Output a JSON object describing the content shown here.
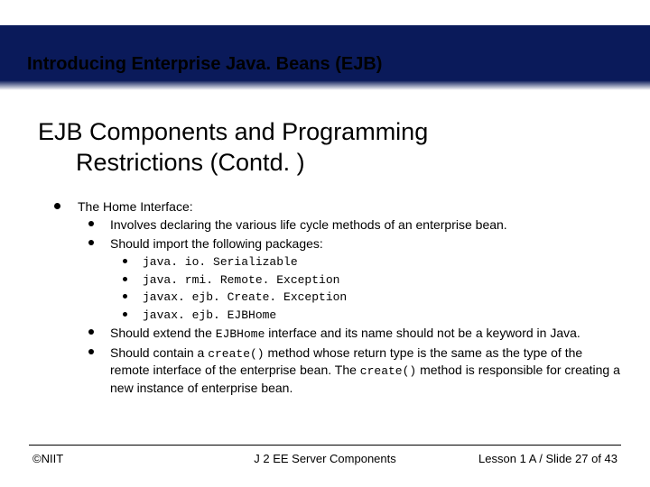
{
  "header": {
    "title": "Introducing Enterprise Java. Beans (EJB)"
  },
  "heading": {
    "line1": "EJB Components and Programming",
    "line2": "Restrictions (Contd. )"
  },
  "bullets": {
    "l1": "The Home Interface:",
    "l2a": "Involves declaring the various life cycle methods of an enterprise bean.",
    "l2b": "Should import the following packages:",
    "pkg1": "java. io. Serializable",
    "pkg2": "java. rmi. Remote. Exception",
    "pkg3": "javax. ejb. Create. Exception",
    "pkg4": "javax. ejb. EJBHome",
    "l2c_pre": "Should extend the ",
    "l2c_code": "EJBHome",
    "l2c_post": " interface and its name should not be a keyword in Java.",
    "l2d_pre": "Should contain a ",
    "l2d_code1": "create()",
    "l2d_mid": " method whose return type is the same as the type of the remote interface of the enterprise bean. The ",
    "l2d_code2": "create()",
    "l2d_post": " method is responsible for creating a new instance of enterprise bean."
  },
  "footer": {
    "left": "©NIIT",
    "center": "J 2 EE Server Components",
    "right": "Lesson 1 A / Slide 27 of 43"
  }
}
